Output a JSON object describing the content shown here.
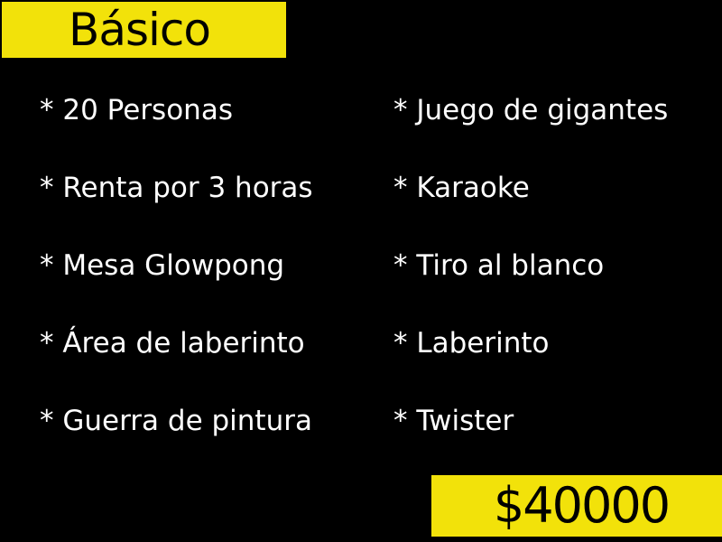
{
  "title": "Básico",
  "left_items": [
    "* 20 Personas",
    "* Renta por 3 horas",
    "* Mesa Glowpong",
    "* Área de laberinto",
    "* Guerra de pintura"
  ],
  "right_items": [
    "* Juego de gigantes",
    "* Karaoke",
    "* Tiro al blanco",
    "* Laberinto",
    "* Twister"
  ],
  "price": "$40000",
  "colors": {
    "background": "#000000",
    "accent": "#f2e20a",
    "text": "#ffffff"
  }
}
